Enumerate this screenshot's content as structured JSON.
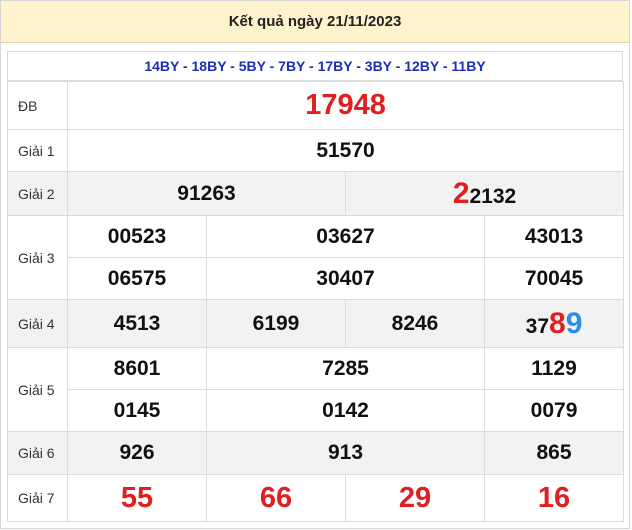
{
  "header": {
    "title": "Kết quả ngày 21/11/2023"
  },
  "codes": "14BY - 18BY - 5BY - 7BY - 17BY - 3BY - 12BY - 11BY",
  "labels": {
    "db": "ĐB",
    "g1": "Giải 1",
    "g2": "Giải 2",
    "g3": "Giải 3",
    "g4": "Giải 4",
    "g5": "Giải 5",
    "g6": "Giải 6",
    "g7": "Giải 7"
  },
  "prizes": {
    "db": "17948",
    "g1": "51570",
    "g2": [
      {
        "lead": "",
        "hl": "",
        "rest": "91263"
      },
      {
        "lead": "",
        "hl": "2",
        "rest": "2132"
      }
    ],
    "g3": [
      "00523",
      "03627",
      "43013",
      "06575",
      "30407",
      "70045"
    ],
    "g4": [
      "4513",
      "6199",
      "8246"
    ],
    "g4_last": {
      "lead": "37",
      "hl_red": "8",
      "hl_blue": "9"
    },
    "g5": [
      "8601",
      "7285",
      "1129",
      "0145",
      "0142",
      "0079"
    ],
    "g6": [
      "926",
      "913",
      "865"
    ],
    "g7": [
      "55",
      "66",
      "29",
      "16"
    ]
  },
  "colors": {
    "red": "#e02020",
    "blue": "#2f8de8",
    "code_blue": "#1b2fb0",
    "header_bg": "#fff3cd"
  }
}
